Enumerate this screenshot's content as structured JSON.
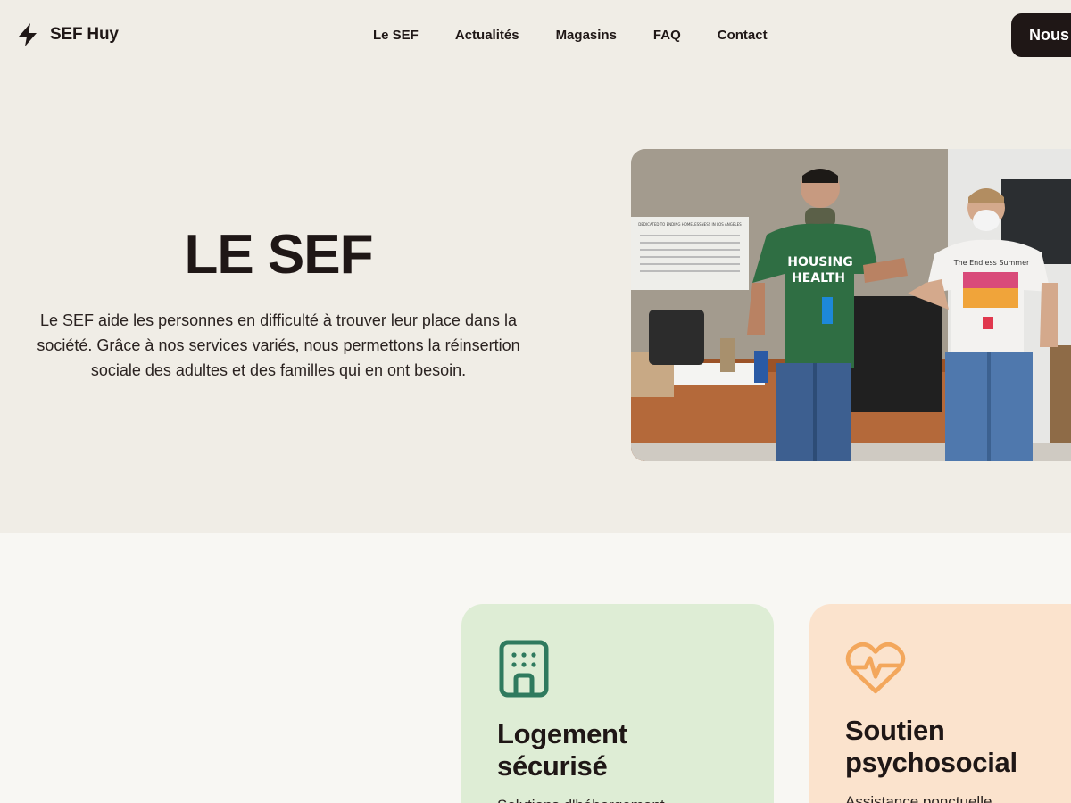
{
  "header": {
    "brand": {
      "icon": "lightning-bolt-icon",
      "name": "SEF Huy"
    },
    "nav": [
      "Le SEF",
      "Actualités",
      "Magasins",
      "FAQ",
      "Contact"
    ],
    "cta_label": "Nous"
  },
  "hero": {
    "title": "LE SEF",
    "description": "Le SEF aide les personnes en difficulté à trouver leur place dans la société. Grâce à nos services variés, nous permettons la réinsertion sociale des adultes et des familles qui en ont besoin.",
    "photo": {
      "plaque_text": "DEDICATED TO ENDING HOMELESSNESS IN LOS ANGELES",
      "shirt_text_left": [
        "HOUSING",
        "HEALTH"
      ],
      "shirt_text_right": "The Endless Summer"
    }
  },
  "services": {
    "cards": [
      {
        "icon": "building-icon",
        "title": "Logement sécurisé",
        "description": "Solutions d'hébergement",
        "background": "#deedd5",
        "icon_color": "#2f7a5e"
      },
      {
        "icon": "heart-pulse-icon",
        "title": "Soutien psychosocial",
        "description": "Assistance ponctuelle",
        "background": "#fbe3cd",
        "icon_color": "#f3a75c"
      }
    ]
  },
  "colors": {
    "hero_bg": "#f0ede6",
    "services_bg": "#f8f7f3",
    "dark": "#1f1716"
  }
}
